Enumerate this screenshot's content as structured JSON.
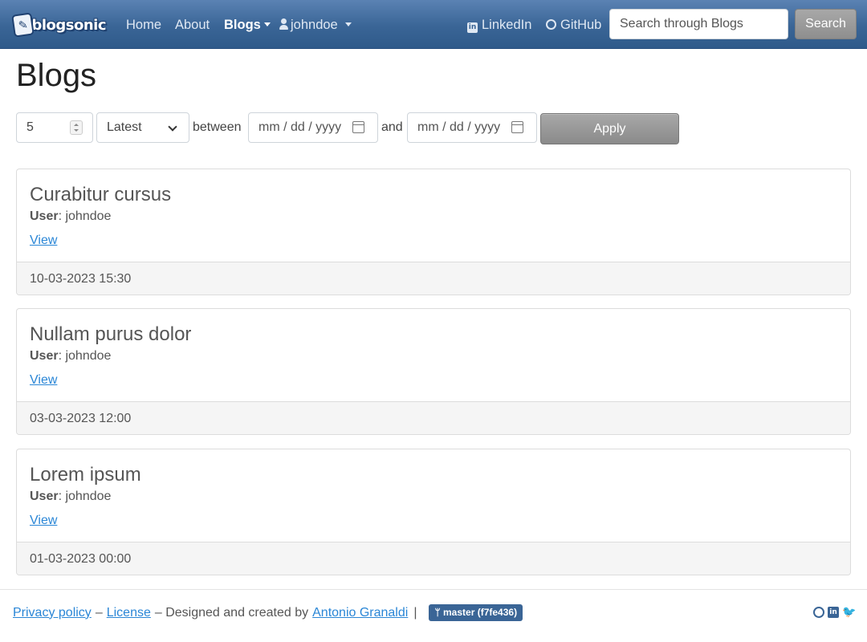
{
  "navbar": {
    "brand": "blogsonic",
    "home": "Home",
    "about": "About",
    "blogs": "Blogs",
    "user": "johndoe",
    "linkedin": "LinkedIn",
    "github": "GitHub",
    "search_placeholder": "Search through Blogs",
    "search_button": "Search"
  },
  "page": {
    "title": "Blogs"
  },
  "filters": {
    "count": "5",
    "order": "Latest",
    "between_label": "between",
    "from_placeholder": "mm / dd / yyyy",
    "and_label": "and",
    "to_placeholder": "mm / dd / yyyy",
    "apply": "Apply"
  },
  "posts": [
    {
      "title": "Curabitur cursus",
      "user_label": "User",
      "user": ": johndoe",
      "view": "View",
      "date": "10-03-2023 15:30"
    },
    {
      "title": "Nullam purus dolor",
      "user_label": "User",
      "user": ": johndoe",
      "view": "View",
      "date": "03-03-2023 12:00"
    },
    {
      "title": "Lorem ipsum",
      "user_label": "User",
      "user": ": johndoe",
      "view": "View",
      "date": "01-03-2023 00:00"
    }
  ],
  "footer": {
    "privacy": "Privacy policy",
    "dash1": "–",
    "license": "License",
    "designed": "– Designed and created by",
    "author": "Antonio Granaldi",
    "pipe": "|",
    "branch": "master (f7fe436)"
  },
  "colors": {
    "navbar": "#3a6596",
    "link": "#2a86d6",
    "button": "#999999"
  },
  "icons": [
    "user-icon",
    "linkedin-icon",
    "github-icon",
    "calendar-icon",
    "twitter-icon",
    "branch-icon"
  ]
}
